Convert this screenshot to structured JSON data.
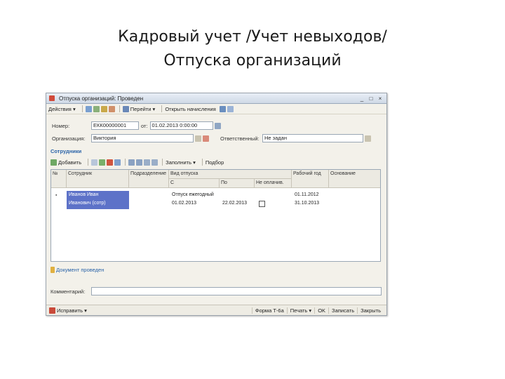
{
  "slide": {
    "title_line1": "Кадровый учет /Учет невыходов/",
    "title_line2": "Отпуска организаций"
  },
  "window": {
    "title": "Отпуска организаций: Проведен",
    "controls": [
      "_",
      "□",
      "×"
    ]
  },
  "toolbar": {
    "actions_label": "Действия",
    "goto_label": "Перейти",
    "accruals_label": "Открыть начисления"
  },
  "form": {
    "number_label": "Номер:",
    "number_value": "ЕКК00000001",
    "date_label": "от:",
    "date_value": "01.02.2013 0:00:00",
    "org_label": "Организация:",
    "org_value": "Виктория",
    "responsible_label": "Ответственный:",
    "responsible_value": "Не задан"
  },
  "employees": {
    "section_title": "Сотрудники",
    "add_label": "Добавить",
    "fill_label": "Заполнить",
    "select_label": "Подбор",
    "columns": {
      "num": "№",
      "employee": "Сотрудник",
      "dept": "Подразделение",
      "type": "Вид отпуска",
      "from": "С",
      "to": "По",
      "noncontinuous": "Не оплачив.",
      "work_year": "Рабочий год",
      "reason": "Основание"
    },
    "rows": [
      {
        "num": "1",
        "name_line1": "Иванов Иван",
        "name_line2": "Иванович (сотр)",
        "type": "Отпуск ежегодный",
        "from": "01.02.2013",
        "to": "22.02.2013",
        "year_from": "01.11.2012",
        "year_to": "31.10.2013"
      }
    ]
  },
  "status": {
    "text": "Документ проведен"
  },
  "comment": {
    "label": "Комментарий:",
    "value": ""
  },
  "bottom": {
    "correct_label": "Исправить",
    "form_label": "Форма Т-6а",
    "print_label": "Печать",
    "ok_label": "OK",
    "write_label": "Записать",
    "close_label": "Закрыть"
  }
}
